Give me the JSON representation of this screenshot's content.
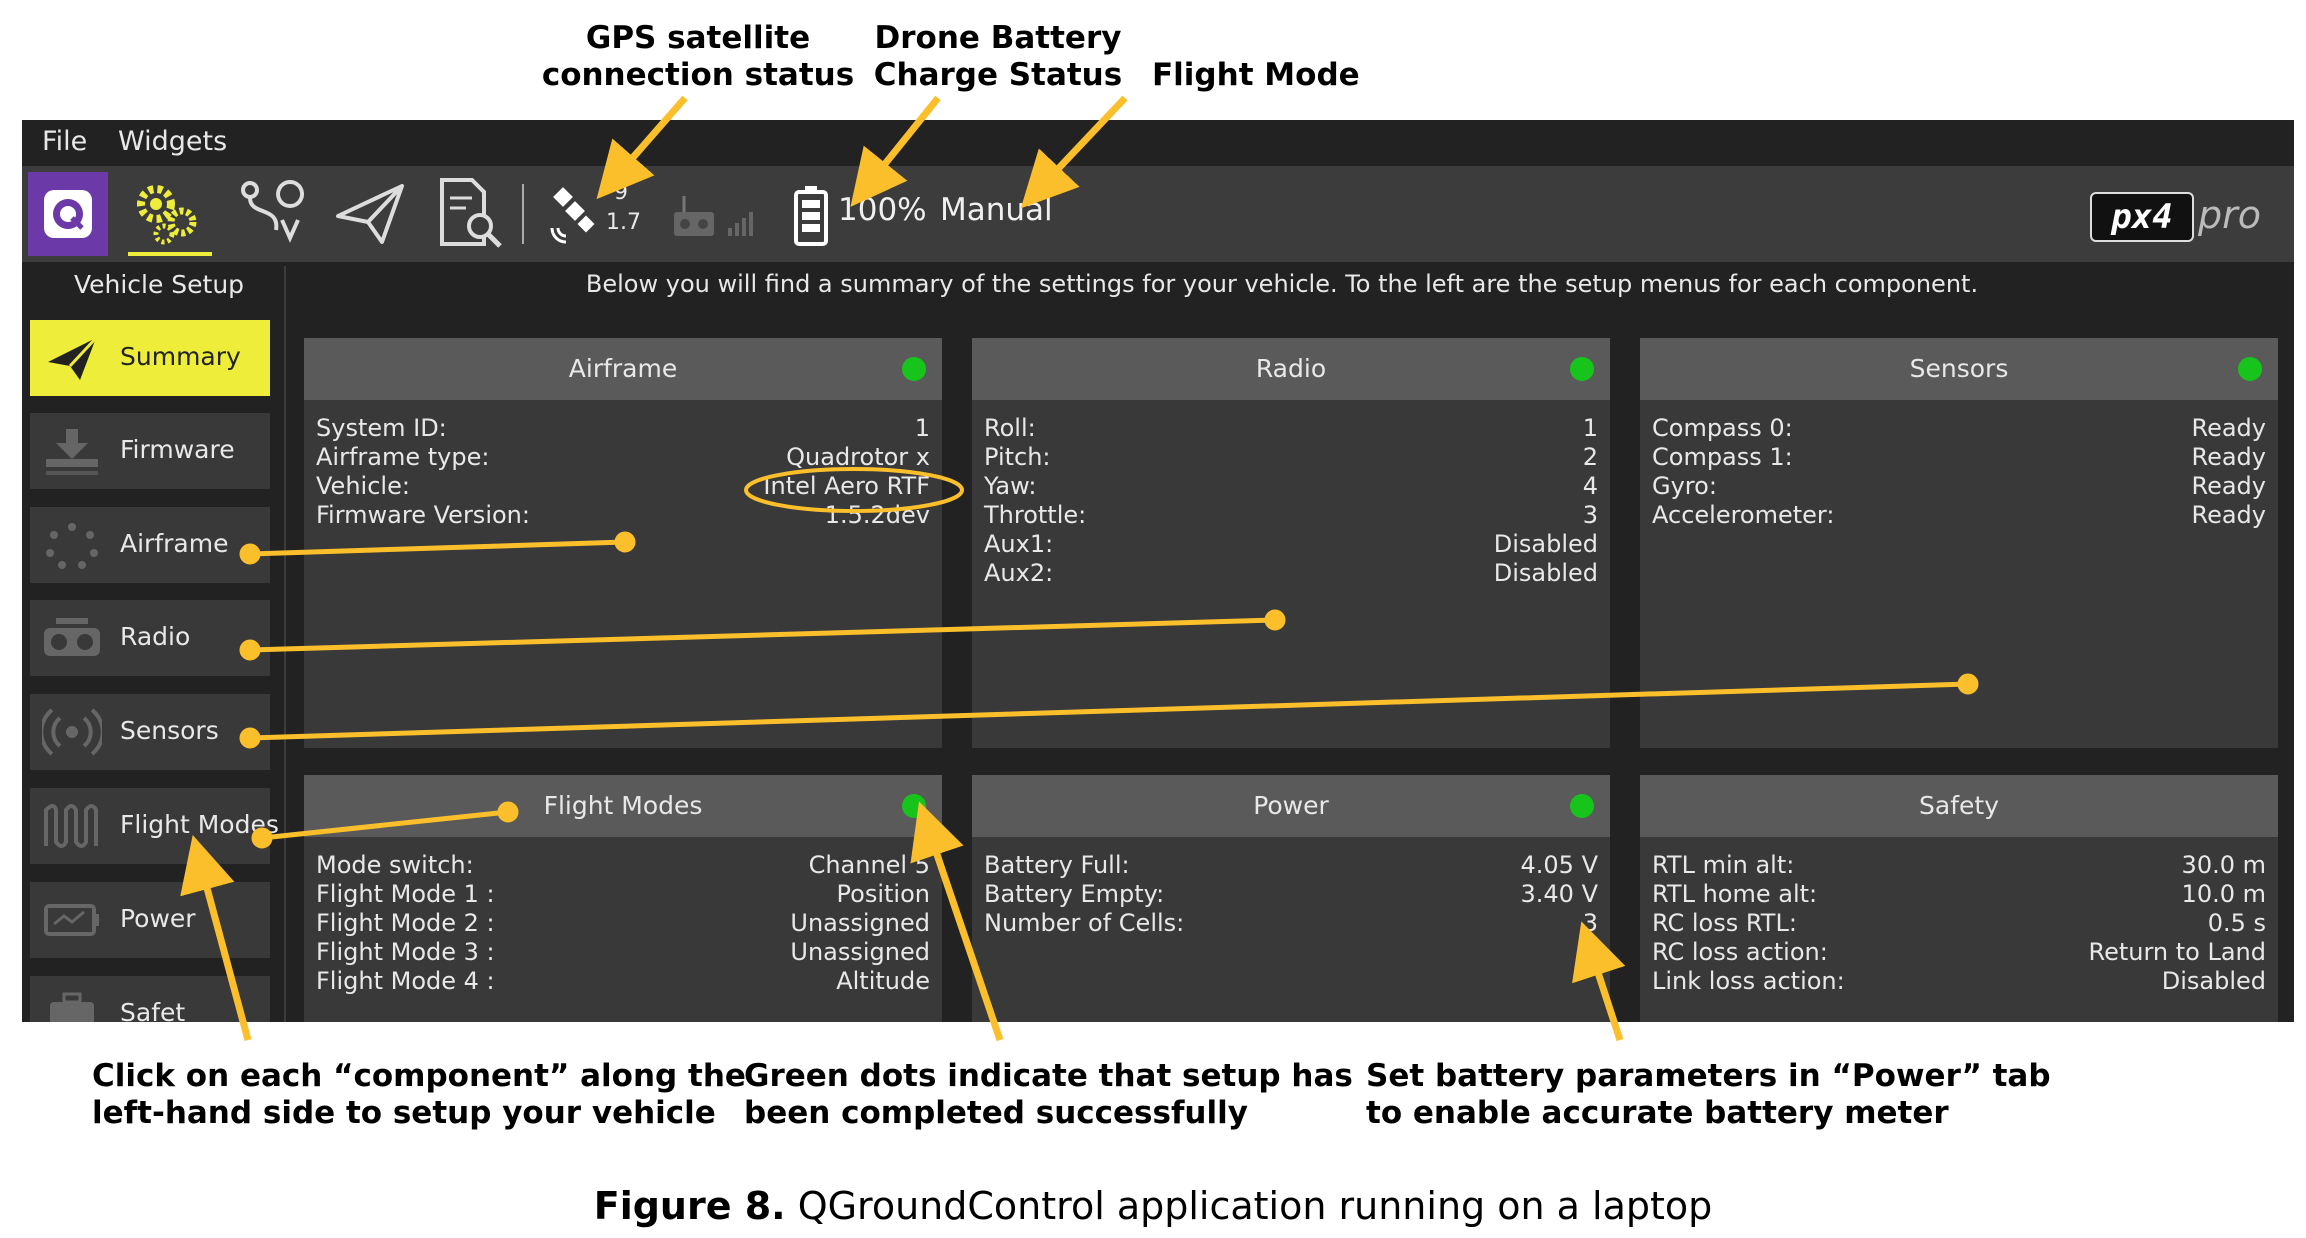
{
  "callouts": {
    "gps": [
      "GPS satellite",
      "connection status"
    ],
    "battery": [
      "Drone Battery",
      "Charge Status"
    ],
    "flight_mode": "Flight Mode",
    "components": [
      "Click on each “component” along the",
      "left-hand side to setup your vehicle"
    ],
    "green_dots": [
      "Green dots indicate that setup has",
      "been completed successfully"
    ],
    "power": [
      "Set battery parameters in “Power” tab",
      "to enable accurate battery meter"
    ]
  },
  "figure_caption": {
    "number": "Figure 8.",
    "text": "QGroundControl application running on a laptop"
  },
  "menu": [
    "File",
    "Widgets"
  ],
  "toolbar": {
    "gps_satellites": "9",
    "gps_hdop": "1.7",
    "battery_percent": "100%",
    "flight_mode": "Manual",
    "logo": "px4 pro",
    "icons": [
      "qgc-logo-icon",
      "gear-setup-icon",
      "plan-route-icon",
      "fly-paper-plane-icon",
      "analyze-document-icon",
      "gps-satellite-icon",
      "rc-transmitter-icon",
      "signal-bars-icon",
      "battery-icon"
    ]
  },
  "sidebar": {
    "title": "Vehicle Setup",
    "items": [
      {
        "label": "Summary",
        "icon": "paper-plane-icon",
        "active": true
      },
      {
        "label": "Firmware",
        "icon": "download-icon",
        "active": false
      },
      {
        "label": "Airframe",
        "icon": "airframe-dots-icon",
        "active": false
      },
      {
        "label": "Radio",
        "icon": "radio-icon",
        "active": false
      },
      {
        "label": "Sensors",
        "icon": "sensors-icon",
        "active": false
      },
      {
        "label": "Flight Modes",
        "icon": "wave-icon",
        "active": false
      },
      {
        "label": "Power",
        "icon": "power-icon",
        "active": false
      },
      {
        "label": "Safet",
        "icon": "safety-icon",
        "active": false
      }
    ]
  },
  "summary_text": "Below you will find a summary of the settings for your vehicle. To the left are the setup menus for each component.",
  "panels": [
    {
      "title": "Airframe",
      "status": "complete",
      "rows": [
        {
          "label": "System ID:",
          "value": "1"
        },
        {
          "label": "Airframe type:",
          "value": "Quadrotor x"
        },
        {
          "label": "Vehicle:",
          "value": "Intel Aero RTF"
        },
        {
          "label": "Firmware Version:",
          "value": "1.5.2dev"
        }
      ]
    },
    {
      "title": "Radio",
      "status": "complete",
      "rows": [
        {
          "label": "Roll:",
          "value": "1"
        },
        {
          "label": "Pitch:",
          "value": "2"
        },
        {
          "label": "Yaw:",
          "value": "4"
        },
        {
          "label": "Throttle:",
          "value": "3"
        },
        {
          "label": "Aux1:",
          "value": "Disabled"
        },
        {
          "label": "Aux2:",
          "value": "Disabled"
        }
      ]
    },
    {
      "title": "Sensors",
      "status": "complete",
      "rows": [
        {
          "label": "Compass 0:",
          "value": "Ready"
        },
        {
          "label": "Compass 1:",
          "value": "Ready"
        },
        {
          "label": "Gyro:",
          "value": "Ready"
        },
        {
          "label": "Accelerometer:",
          "value": "Ready"
        }
      ]
    },
    {
      "title": "Flight Modes",
      "status": "complete",
      "rows": [
        {
          "label": "Mode switch:",
          "value": "Channel 5"
        },
        {
          "label": "Flight Mode 1 :",
          "value": "Position"
        },
        {
          "label": "Flight Mode 2 :",
          "value": "Unassigned"
        },
        {
          "label": "Flight Mode 3 :",
          "value": "Unassigned"
        },
        {
          "label": "Flight Mode 4 :",
          "value": "Altitude"
        }
      ]
    },
    {
      "title": "Power",
      "status": "complete",
      "rows": [
        {
          "label": "Battery Full:",
          "value": "4.05 V"
        },
        {
          "label": "Battery Empty:",
          "value": "3.40 V"
        },
        {
          "label": "Number of Cells:",
          "value": "3"
        }
      ]
    },
    {
      "title": "Safety",
      "status": "none",
      "rows": [
        {
          "label": "RTL min alt:",
          "value": "30.0 m"
        },
        {
          "label": "RTL home alt:",
          "value": "10.0 m"
        },
        {
          "label": "RC loss RTL:",
          "value": "0.5 s"
        },
        {
          "label": "RC loss action:",
          "value": "Return to Land"
        },
        {
          "label": "Link loss action:",
          "value": "Disabled"
        }
      ]
    }
  ],
  "colors": {
    "annotation": "#fbbf2c",
    "status_ok": "#16c41c",
    "active_tab": "#eeee3a",
    "panel_header": "#5a5a5a",
    "panel_body": "#393939",
    "background": "#222222"
  }
}
